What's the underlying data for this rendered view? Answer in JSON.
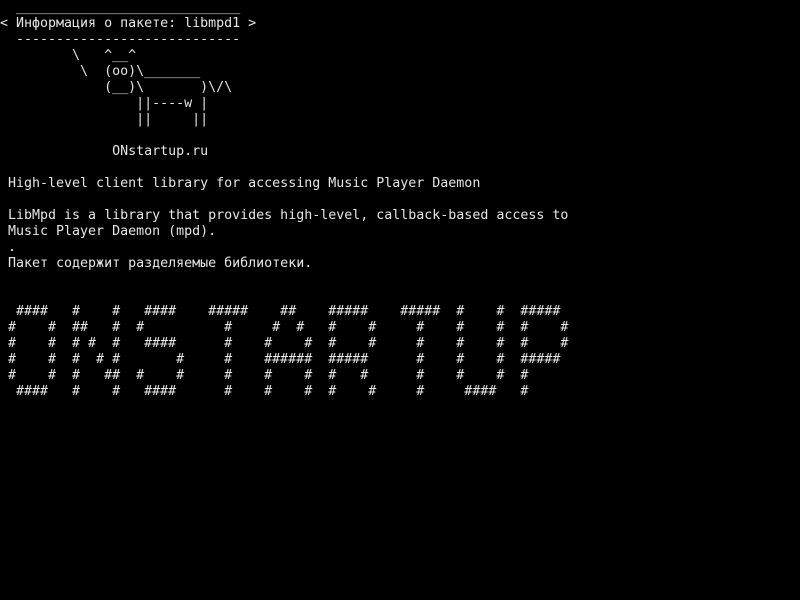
{
  "terminal": {
    "background": "#000000",
    "foreground": "#e6e6e6",
    "bubble": {
      "top_border": " ____________________________",
      "title": "< Информация о пакете: libmpd1 >",
      "bottom_border": " ----------------------------"
    },
    "cow": [
      "        \\   ^__^",
      "         \\  (oo)\\_______",
      "            (__)\\       )\\/\\",
      "                ||----w |",
      "                ||     ||"
    ],
    "site": "             ONstartup.ru",
    "summary": "High-level client library for accessing Music Player Daemon",
    "description": [
      "LibMpd is a library that provides high-level, callback-based access to",
      "Music Player Daemon (mpd).",
      ".",
      "Пакет содержит разделяемые библиотеки."
    ],
    "banner": [
      " ####   #    #   ####    #####    ##    #####    #####  #    #  #####",
      "#    #  ##   #  #          #     #  #   #    #     #    #    #  #    #",
      "#    #  # #  #   ####      #    #    #  #    #     #    #    #  #    #",
      "#    #  #  # #       #     #    ######  #####      #    #    #  #####",
      "#    #  #   ##  #    #     #    #    #  #   #      #    #    #  #",
      " ####   #    #   ####      #    #    #  #    #     #     ####   #"
    ]
  }
}
